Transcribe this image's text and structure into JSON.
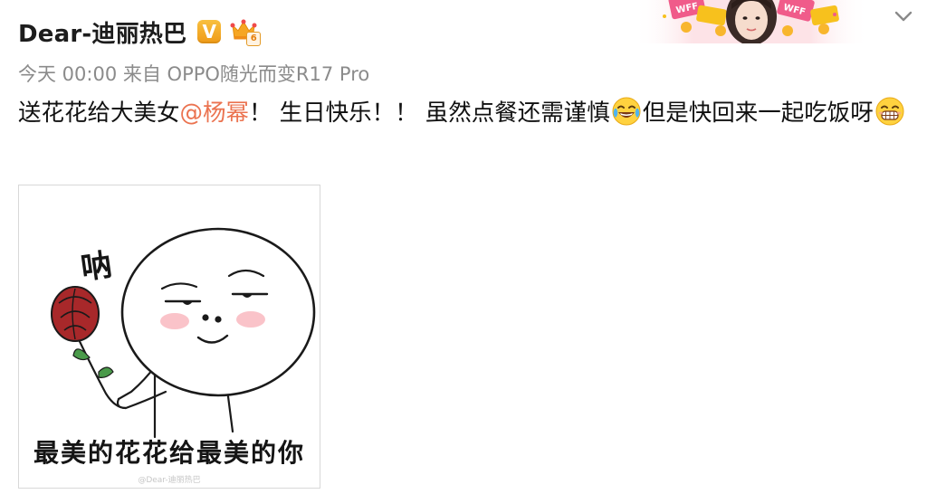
{
  "header": {
    "username": "Dear-迪丽热巴",
    "vip_badge_text": "V",
    "crown_level": "6",
    "expand_icon": "chevron-down-icon",
    "banner_text": "WFF"
  },
  "meta": {
    "text": "今天 00:00 来自 OPPO随光而变R17 Pro"
  },
  "post": {
    "text_part1": "送花花给大美女",
    "mention": "@杨幂",
    "text_part2": "！ 生日快乐！！ 虽然点餐还需谨慎",
    "text_part3": "但是快回来一起吃饭呀",
    "emoji1": "laugh-tears-emoji",
    "emoji2": "grin-emoji",
    "mention_color": "#eb7350"
  },
  "image": {
    "word": "呐",
    "caption": "最美的花花给最美的你",
    "watermark": "@Dear-迪丽热巴"
  }
}
